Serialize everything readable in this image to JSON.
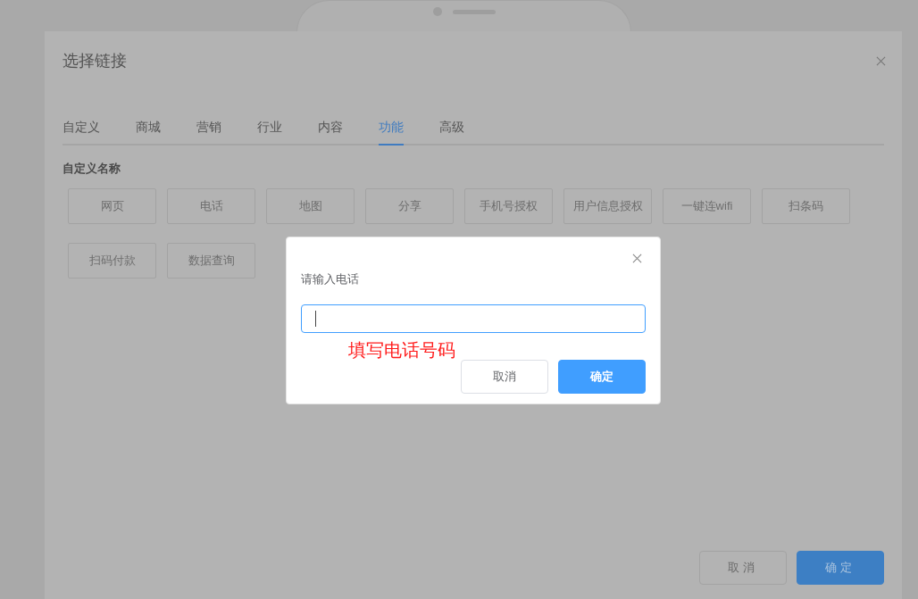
{
  "dialog": {
    "title": "选择链接",
    "tabs": [
      {
        "label": "自定义",
        "selected": false
      },
      {
        "label": "商城",
        "selected": false
      },
      {
        "label": "营销",
        "selected": false
      },
      {
        "label": "行业",
        "selected": false
      },
      {
        "label": "内容",
        "selected": false
      },
      {
        "label": "功能",
        "selected": true
      },
      {
        "label": "高级",
        "selected": false
      }
    ],
    "section_label": "自定义名称",
    "options": [
      "网页",
      "电话",
      "地图",
      "分享",
      "手机号授权",
      "用户信息授权",
      "一键连wifi",
      "扫条码",
      "扫码付款",
      "数据查询"
    ],
    "footer_buttons": [
      {
        "label": "取消",
        "kind": "secondary"
      },
      {
        "label": "确定",
        "kind": "primary"
      }
    ]
  },
  "modal": {
    "label": "请输入电话",
    "input": {
      "focused": true
    },
    "annotation": "填写电话号码",
    "buttons": [
      {
        "label": "取消",
        "kind": "secondary"
      },
      {
        "label": "确定",
        "kind": "primary"
      }
    ]
  }
}
